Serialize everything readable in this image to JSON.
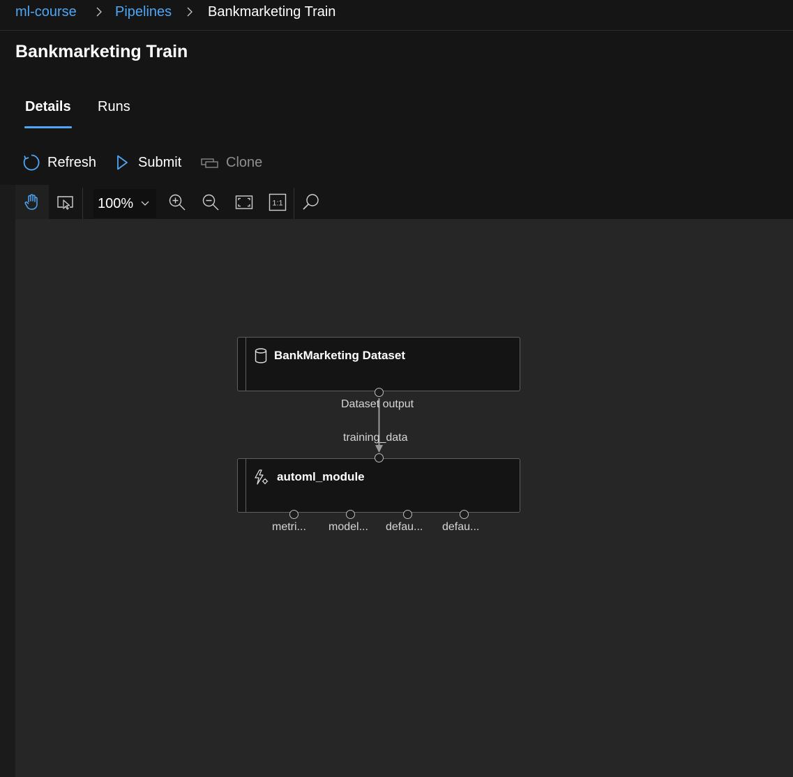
{
  "breadcrumb": {
    "workspace": "ml-course",
    "section": "Pipelines",
    "current": "Bankmarketing Train"
  },
  "page": {
    "title": "Bankmarketing Train"
  },
  "tabs": [
    {
      "label": "Details",
      "active": true
    },
    {
      "label": "Runs",
      "active": false
    }
  ],
  "commands": {
    "refresh": "Refresh",
    "submit": "Submit",
    "clone": "Clone"
  },
  "canvas_toolbar": {
    "zoom": "100%"
  },
  "graph": {
    "nodes": [
      {
        "title": "BankMarketing Dataset",
        "icon": "database-icon",
        "output_label": "Dataset output"
      },
      {
        "title": "automl_module",
        "icon": "automl-icon",
        "input_label": "training_data",
        "outputs": [
          "metri...",
          "model...",
          "defau...",
          "defau..."
        ]
      }
    ]
  },
  "colors": {
    "accent": "#4ea6f5",
    "background": "#151515",
    "canvas": "#262626"
  }
}
